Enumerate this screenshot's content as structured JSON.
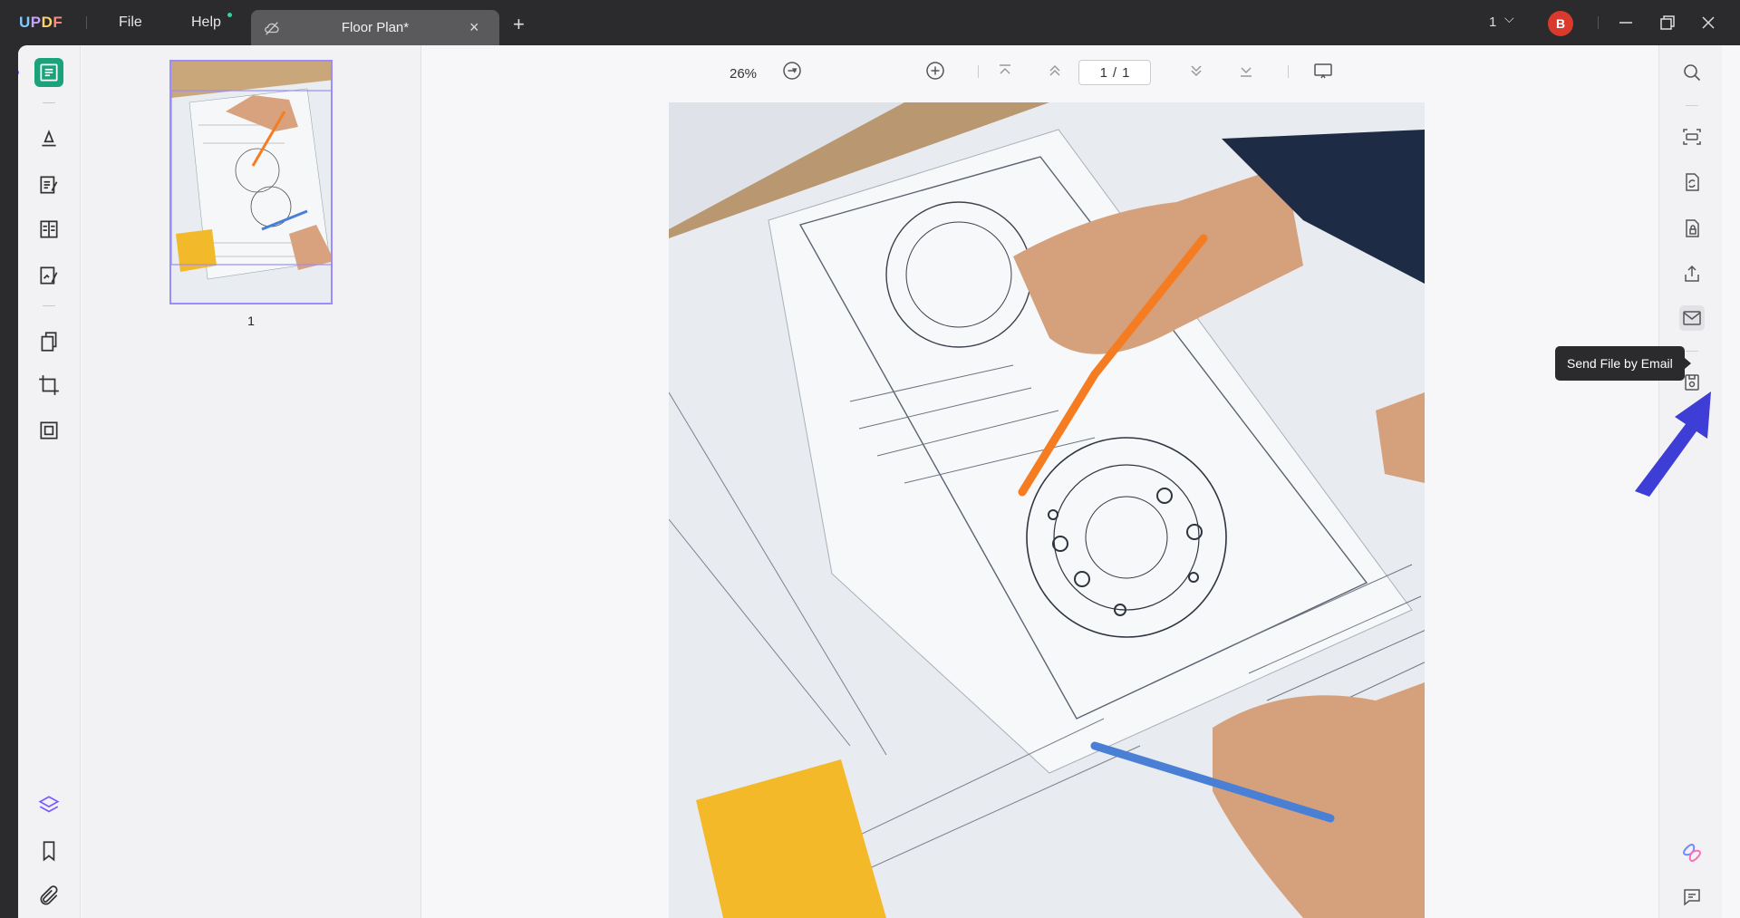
{
  "app": {
    "logo": [
      "U",
      "P",
      "D",
      "F"
    ],
    "menu": {
      "file": "File",
      "help": "Help"
    },
    "tab": {
      "title": "Floor Plan*",
      "close": "×",
      "add": "+"
    },
    "windows": {
      "count": "1",
      "chevron": "⌵"
    },
    "user": {
      "avatar": "B"
    }
  },
  "viewer": {
    "zoom": "26%",
    "zoom_caret": "▾",
    "page": {
      "current": "1",
      "sep": "/",
      "total": "1"
    }
  },
  "thumbnails": [
    {
      "label": "1"
    }
  ],
  "tooltip": {
    "text": "Send File by Email"
  },
  "colors": {
    "accent": "#1aa37a",
    "selection": "#9b8cff",
    "arrow": "#3e3ed6",
    "avatar": "#d93a2b"
  }
}
